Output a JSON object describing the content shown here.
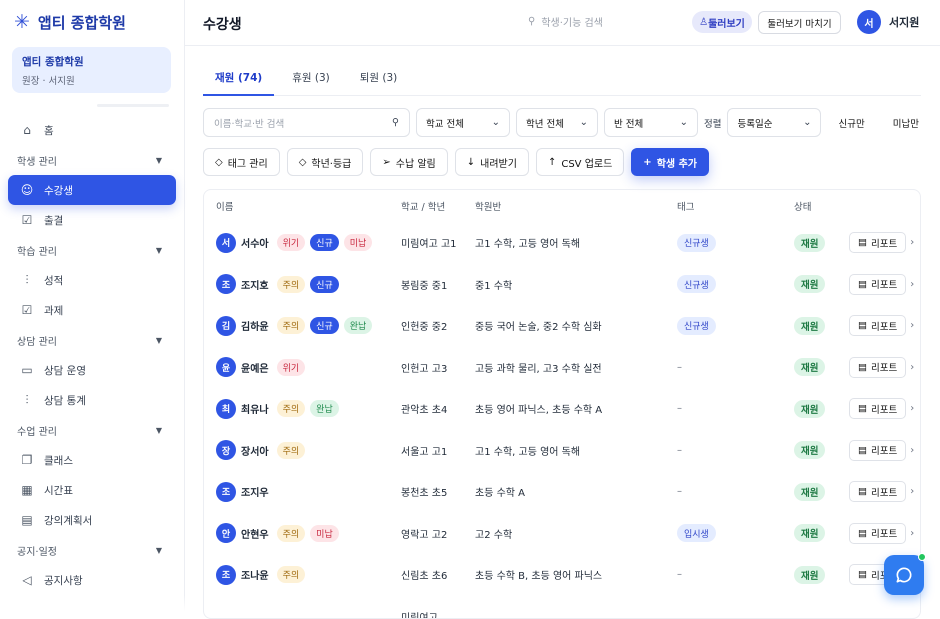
{
  "brand": {
    "name": "앱티 종합학원"
  },
  "org": {
    "name": "앱티 종합학원",
    "role": "원장 · 서지원"
  },
  "nav": {
    "home": "홈",
    "students_section": "학생 관리",
    "students": "수강생",
    "attendance": "출결",
    "learning_section": "학습 관리",
    "grades": "성적",
    "assignments": "과제",
    "counseling_section": "상담 관리",
    "counseling_ops": "상담 운영",
    "counseling_stats": "상담 통계",
    "class_section": "수업 관리",
    "classes": "클래스",
    "timetable": "시간표",
    "syllabus": "강의계획서",
    "notice_section": "공지·일정",
    "notices": "공지사항"
  },
  "header": {
    "title": "수강생",
    "search_placeholder": "학생·기능 검색",
    "peek": "둘러보기",
    "stop_peek": "둘러보기 마치기",
    "user_initial": "서",
    "user_name": "서지원"
  },
  "tabs": [
    "재원 (74)",
    "휴원 (3)",
    "퇴원 (3)"
  ],
  "filters": {
    "search_placeholder": "이름·학교·반 검색",
    "school": "학교 전체",
    "grade": "학년 전체",
    "class": "반 전체",
    "sort_label": "정렬",
    "sort": "등록일순",
    "new_only": "신규만",
    "unpaid_only": "미납만"
  },
  "actions": {
    "tags": "태그 관리",
    "grade_level": "학년·등급",
    "billing": "수납 알림",
    "download": "내려받기",
    "csv": "CSV 업로드",
    "add": "학생 추가"
  },
  "table": {
    "headers": {
      "name": "이름",
      "school": "학교 / 학년",
      "class": "학원반",
      "tag": "태그",
      "status": "상태"
    },
    "report_label": "리포트",
    "rows": [
      {
        "initial": "서",
        "name": "서수아",
        "badges": [
          {
            "t": "위기",
            "k": "risk"
          },
          {
            "t": "신규",
            "k": "new"
          },
          {
            "t": "미납",
            "k": "unpaid"
          }
        ],
        "school": "미림여고 고1",
        "class": "고1 수학, 고등 영어 독해",
        "tag": "신규생",
        "status": "재원"
      },
      {
        "initial": "조",
        "name": "조지호",
        "badges": [
          {
            "t": "주의",
            "k": "warn"
          },
          {
            "t": "신규",
            "k": "new"
          }
        ],
        "school": "봉림중 중1",
        "class": "중1 수학",
        "tag": "신규생",
        "status": "재원"
      },
      {
        "initial": "김",
        "name": "김하윤",
        "badges": [
          {
            "t": "주의",
            "k": "warn"
          },
          {
            "t": "신규",
            "k": "new"
          },
          {
            "t": "완납",
            "k": "paid"
          }
        ],
        "school": "인헌중 중2",
        "class": "중등 국어 논술, 중2 수학 심화",
        "tag": "신규생",
        "status": "재원"
      },
      {
        "initial": "윤",
        "name": "윤예은",
        "badges": [
          {
            "t": "위기",
            "k": "risk"
          }
        ],
        "school": "인헌고 고3",
        "class": "고등 과학 물리, 고3 수학 실전",
        "tag": "–",
        "status": "재원"
      },
      {
        "initial": "최",
        "name": "최유나",
        "badges": [
          {
            "t": "주의",
            "k": "warn"
          },
          {
            "t": "완납",
            "k": "paid"
          }
        ],
        "school": "관악초 초4",
        "class": "초등 영어 파닉스, 초등 수학 A",
        "tag": "–",
        "status": "재원"
      },
      {
        "initial": "장",
        "name": "장서아",
        "badges": [
          {
            "t": "주의",
            "k": "warn"
          }
        ],
        "school": "서울고 고1",
        "class": "고1 수학, 고등 영어 독해",
        "tag": "–",
        "status": "재원"
      },
      {
        "initial": "조",
        "name": "조지우",
        "badges": [],
        "school": "봉천초 초5",
        "class": "초등 수학 A",
        "tag": "–",
        "status": "재원"
      },
      {
        "initial": "안",
        "name": "안현우",
        "badges": [
          {
            "t": "주의",
            "k": "warn"
          },
          {
            "t": "미납",
            "k": "unpaid"
          }
        ],
        "school": "영락고 고2",
        "class": "고2 수학",
        "tag": "입시생",
        "status": "재원"
      },
      {
        "initial": "조",
        "name": "조나윤",
        "badges": [
          {
            "t": "주의",
            "k": "warn"
          }
        ],
        "school": "신림초 초6",
        "class": "초등 수학 B, 초등 영어 파닉스",
        "tag": "–",
        "status": "재원"
      },
      {
        "initial": "",
        "name": "",
        "badges": [],
        "school": "미림여고",
        "class": "",
        "tag": "",
        "status": ""
      }
    ]
  },
  "colors": {
    "accent": "#2f55e4",
    "brand": "#1e3aa8",
    "status_green": "#1e7a44"
  }
}
